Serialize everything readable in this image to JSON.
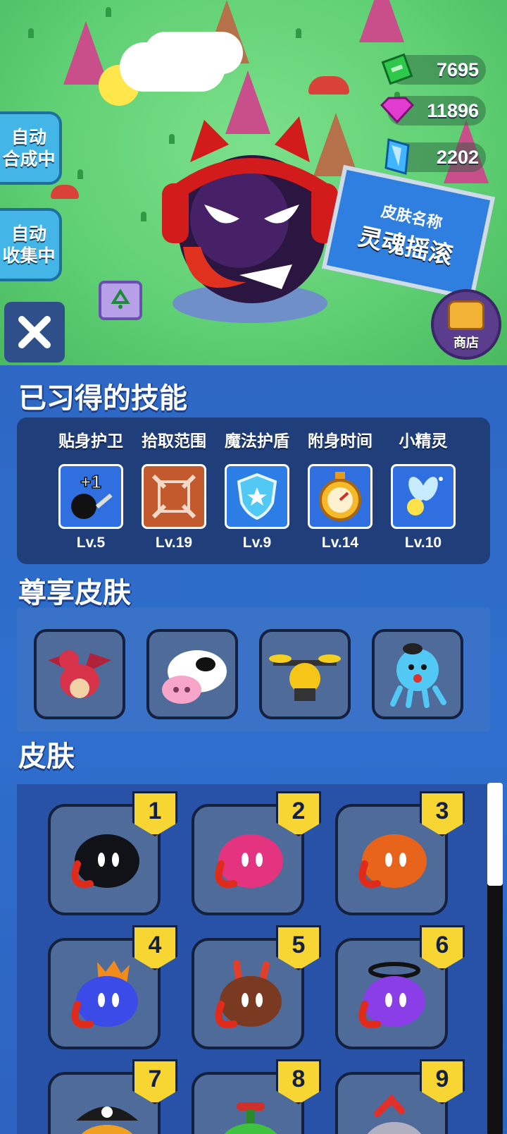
{
  "currencies": [
    {
      "name": "green-gem",
      "value": "7695",
      "color": "#2ec84a"
    },
    {
      "name": "pink-gem",
      "value": "11896",
      "color": "#e23bd0"
    },
    {
      "name": "blue-crystal",
      "value": "2202",
      "color": "#3fb6ff"
    }
  ],
  "side_buttons": {
    "auto_merge": "自动\n合成中",
    "auto_collect": "自动\n收集中"
  },
  "shop": {
    "label": "商店"
  },
  "sign": {
    "line1": "皮肤名称",
    "line2": "灵魂摇滚"
  },
  "sections": {
    "learned_skills": "已习得的技能",
    "premium_skins": "尊享皮肤",
    "skins": "皮肤"
  },
  "skills": [
    {
      "name": "贴身护卫",
      "level": "Lv.5",
      "icon": "guard-icon",
      "badge": "+1"
    },
    {
      "name": "拾取范围",
      "level": "Lv.19",
      "icon": "range-icon"
    },
    {
      "name": "魔法护盾",
      "level": "Lv.9",
      "icon": "shield-icon"
    },
    {
      "name": "附身时间",
      "level": "Lv.14",
      "icon": "stopwatch-icon"
    },
    {
      "name": "小精灵",
      "level": "Lv.10",
      "icon": "fairy-icon"
    }
  ],
  "premium_skins": [
    {
      "name": "dragon"
    },
    {
      "name": "cow"
    },
    {
      "name": "drone"
    },
    {
      "name": "octopus"
    }
  ],
  "skins": [
    {
      "number": "1",
      "color": "#111118"
    },
    {
      "number": "2",
      "color": "#e5347f"
    },
    {
      "number": "3",
      "color": "#e8641a"
    },
    {
      "number": "4",
      "color": "#3a4be8"
    },
    {
      "number": "5",
      "color": "#7a3a22"
    },
    {
      "number": "6",
      "color": "#8a3ee8"
    },
    {
      "number": "7",
      "color": "#f0a020"
    },
    {
      "number": "8",
      "color": "#3fc23f"
    },
    {
      "number": "9",
      "color": "#b0b0c0"
    }
  ]
}
